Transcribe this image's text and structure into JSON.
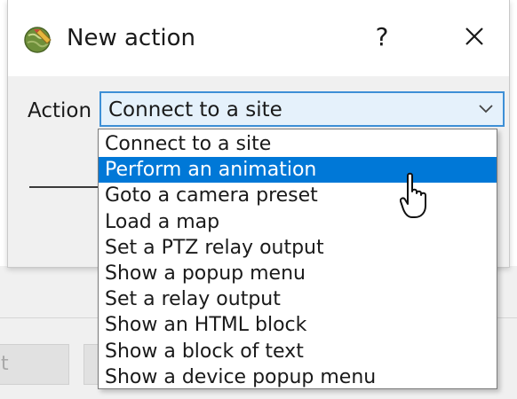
{
  "dialog": {
    "title": "New action",
    "help_label": "?",
    "close_icon": "close-icon",
    "app_icon": "globe-pencil-icon"
  },
  "action": {
    "label": "Action",
    "selected_value": "Connect to a site",
    "dropdown_icon": "chevron-down-icon"
  },
  "dropdown": {
    "highlighted_index": 1,
    "options": [
      "Connect to a site",
      "Perform an animation",
      "Goto a camera preset",
      "Load a map",
      "Set a PTZ relay output",
      "Show a popup menu",
      "Set a relay output",
      "Show an HTML block",
      "Show a block of text",
      "Show a device popup menu"
    ]
  },
  "background": {
    "button_1_label": "t"
  },
  "colors": {
    "selection": "#0078d7",
    "combo_border": "#3d8fd6",
    "combo_fill": "#e5f1fb"
  }
}
